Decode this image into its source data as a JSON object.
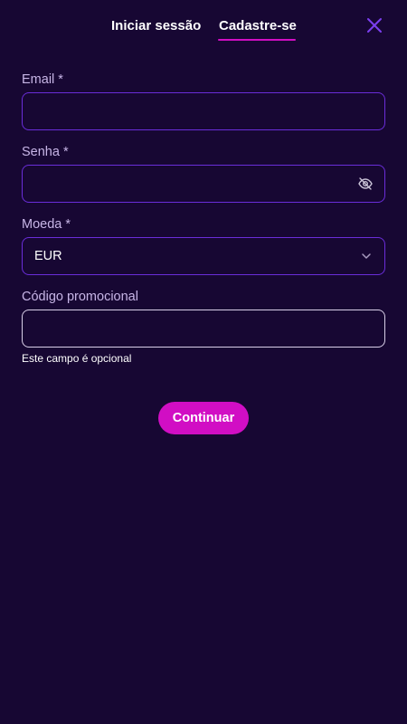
{
  "tabs": {
    "login_label": "Iniciar sessão",
    "register_label": "Cadastre-se",
    "active": "register"
  },
  "close": {
    "icon": "close-icon"
  },
  "form": {
    "email": {
      "label": "Email *",
      "value": "",
      "placeholder": ""
    },
    "password": {
      "label": "Senha *",
      "value": "",
      "placeholder": "",
      "toggle_icon": "eye-off-icon"
    },
    "currency": {
      "label": "Moeda *",
      "selected": "EUR",
      "icon": "chevron-down-icon"
    },
    "promo": {
      "label": "Código promocional",
      "value": "",
      "placeholder": "",
      "helper": "Este campo é opcional"
    },
    "submit_label": "Continuar"
  },
  "colors": {
    "background": "#170733",
    "accent": "#d10ec4",
    "field_border": "#6a2dd9",
    "label": "#c7b5e6",
    "close_icon": "#7b3ff0"
  }
}
